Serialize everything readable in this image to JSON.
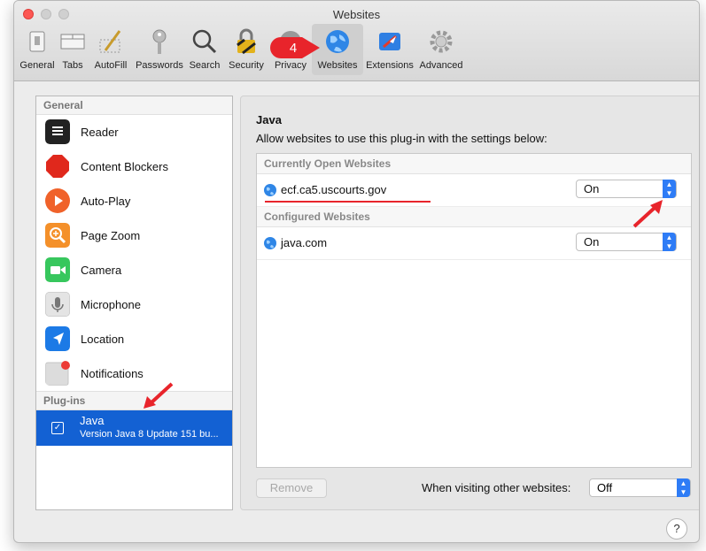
{
  "window": {
    "title": "Websites"
  },
  "toolbar": {
    "items": [
      {
        "label": "General",
        "icon": "general-switch-icon"
      },
      {
        "label": "Tabs",
        "icon": "tabs-icon"
      },
      {
        "label": "AutoFill",
        "icon": "pencil-form-icon"
      },
      {
        "label": "Passwords",
        "icon": "key-icon"
      },
      {
        "label": "Search",
        "icon": "magnifier-icon"
      },
      {
        "label": "Security",
        "icon": "padlock-icon"
      },
      {
        "label": "Privacy",
        "icon": "hand-icon"
      },
      {
        "label": "Websites",
        "icon": "globe-icon",
        "active": true
      },
      {
        "label": "Extensions",
        "icon": "puzzle-icon"
      },
      {
        "label": "Advanced",
        "icon": "gear-icon"
      }
    ],
    "step_badge": "4"
  },
  "sidebar": {
    "general_heading": "General",
    "items": [
      {
        "label": "Reader",
        "icon": "reader-icon"
      },
      {
        "label": "Content Blockers",
        "icon": "stop-icon"
      },
      {
        "label": "Auto-Play",
        "icon": "play-icon"
      },
      {
        "label": "Page Zoom",
        "icon": "zoom-icon"
      },
      {
        "label": "Camera",
        "icon": "camera-icon"
      },
      {
        "label": "Microphone",
        "icon": "microphone-icon"
      },
      {
        "label": "Location",
        "icon": "location-icon"
      },
      {
        "label": "Notifications",
        "icon": "notification-icon"
      }
    ],
    "plugins_heading": "Plug-ins",
    "plugin": {
      "name": "Java",
      "version": "Version Java 8 Update 151 bu..."
    }
  },
  "main": {
    "heading": "Java",
    "description": "Allow websites to use this plug-in with the settings below:",
    "current_heading": "Currently Open Websites",
    "configured_heading": "Configured Websites",
    "current_sites": [
      {
        "site": "ecf.ca5.uscourts.gov",
        "setting": "On"
      }
    ],
    "configured_sites": [
      {
        "site": "java.com",
        "setting": "On"
      }
    ],
    "remove_label": "Remove",
    "visiting_label": "When visiting other websites:",
    "visiting_value": "Off",
    "help_label": "?"
  },
  "colors": {
    "accent": "#1361d3",
    "annotation": "#e8242b",
    "select_arrow": "#2e7cf6"
  }
}
